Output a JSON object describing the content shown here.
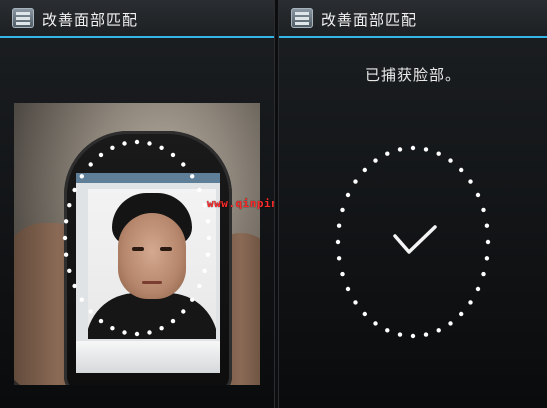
{
  "left_panel": {
    "action_bar": {
      "title": "改善面部匹配",
      "icon": "face-unlock-app-icon"
    },
    "preview": {
      "watermark": "www.qinpinchang.com"
    }
  },
  "right_panel": {
    "action_bar": {
      "title": "改善面部匹配",
      "icon": "face-unlock-app-icon"
    },
    "status_text": "已捕获脸部。",
    "result_icon": "checkmark-icon"
  },
  "colors": {
    "accent_underline": "#34b5e5",
    "dots": "#ffffff",
    "watermark": "#ff2b2b"
  }
}
